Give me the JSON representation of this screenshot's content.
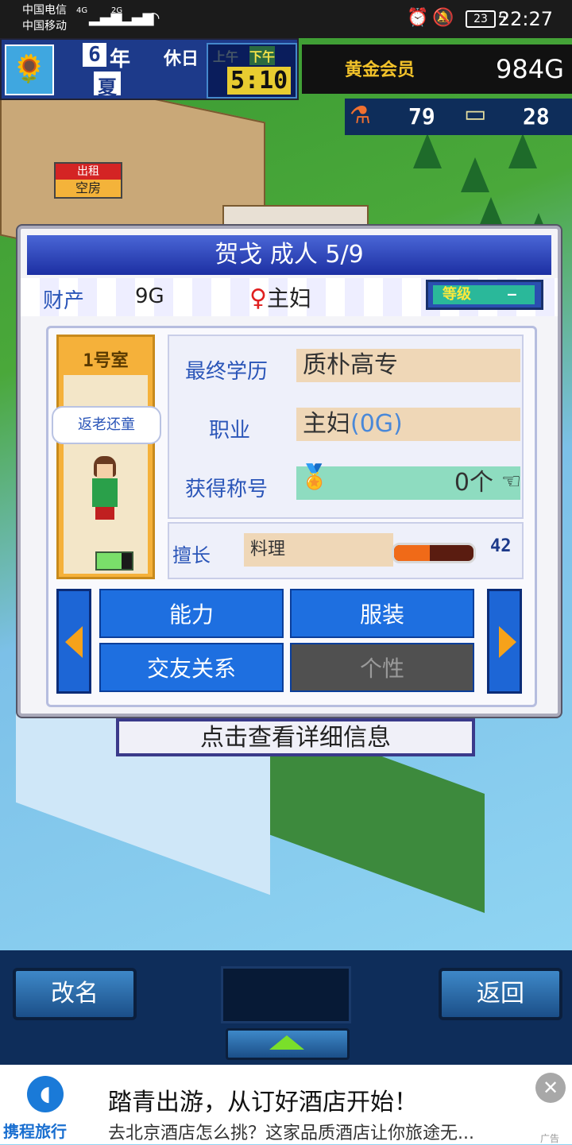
{
  "status_bar": {
    "carrier_1": "中国电信",
    "carrier_2": "中国移动",
    "net_1": "4G",
    "net_2": "2G",
    "battery": "23",
    "time": "22:27"
  },
  "hud": {
    "year": "6",
    "year_unit": "年",
    "holiday": "休日",
    "season_label": "夏",
    "am": "上午",
    "pm": "下午",
    "clock": "5:10",
    "gold_member": "黄金会员",
    "money": "984G",
    "research_points": "79",
    "tickets": "28"
  },
  "world": {
    "rent_sign_top": "出租",
    "rent_sign_bottom": "空房"
  },
  "dialog": {
    "title": "贺戈 成人 5/9",
    "assets_label": "财产",
    "assets_value": "9G",
    "gender_symbol": "♀",
    "job_short": "主妇",
    "grade_label": "等级",
    "grade_value": "—",
    "room_label": "1号室",
    "speech": "返老还童",
    "education_label": "最终学历",
    "education_value": "质朴高专",
    "job_label": "职业",
    "job_value": "主妇",
    "job_salary": "(0G)",
    "title_label": "获得称号",
    "title_count": "0个",
    "skill_label": "擅长",
    "skill_value": "料理",
    "skill_level": "42",
    "skill_fill": 0.45,
    "tab_ability": "能力",
    "tab_clothing": "服装",
    "tab_friends": "交友关系",
    "tab_personality": "个性"
  },
  "detail_button": "点击查看详细信息",
  "bottom": {
    "rename": "改名",
    "back": "返回"
  },
  "ad": {
    "brand": "携程旅行",
    "headline": "踏青出游，从订好酒店开始！",
    "subline": "去北京酒店怎么挑？这家品质酒店让你旅途无...",
    "tag": "广告"
  }
}
